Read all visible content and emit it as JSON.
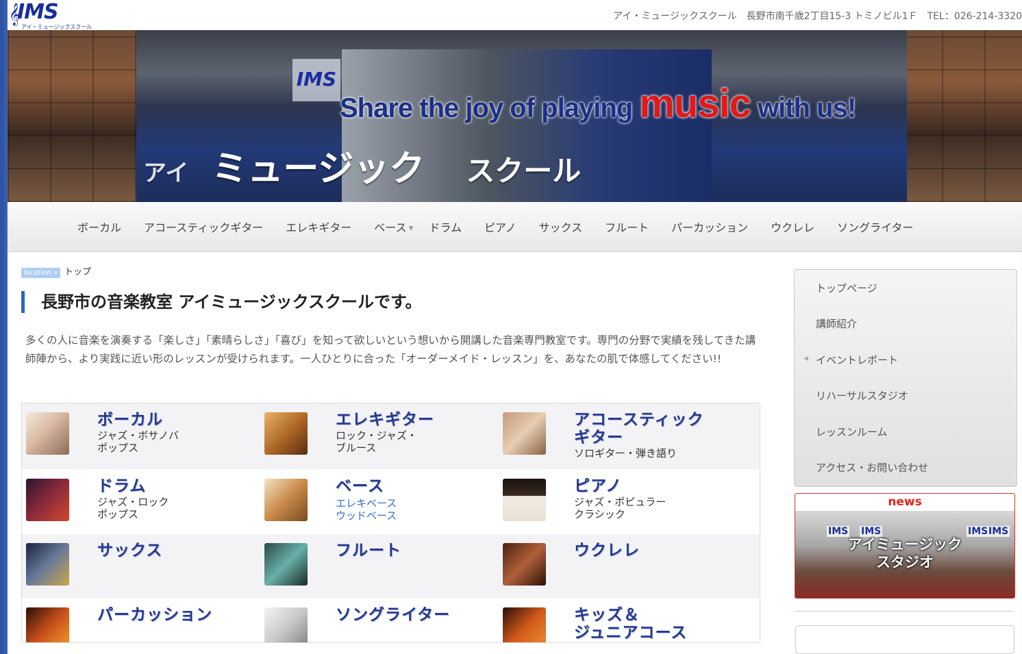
{
  "header": {
    "logo_text": "IMS",
    "logo_sub": "アイ・ミュージックスクール",
    "address": "アイ・ミュージックスクール　長野市南千歳2丁目15-3 トミノビル1Ｆ　TEL：026-214-3320"
  },
  "banner": {
    "slogan_pre": "Share the joy of playing ",
    "slogan_music": "music",
    "slogan_post": " with us!",
    "jp_a": "アイ",
    "jp_main": "ミュージック",
    "jp_school": "スクール",
    "logo": "IMS"
  },
  "nav": {
    "items": [
      "ボーカル",
      "アコースティックギター",
      "エレキギター",
      "ベース",
      "ドラム",
      "ピアノ",
      "サックス",
      "フルート",
      "パーカッション",
      "ウクレレ",
      "ソングライター"
    ]
  },
  "breadcrumb": {
    "tag": "location »",
    "current": "トップ"
  },
  "main": {
    "title": "長野市の音楽教室 アイミュージックスクールです。",
    "intro": "多くの人に音楽を演奏する「楽しさ」「素晴らしさ」「喜び」を知って欲しいという想いから開講した音楽専門教室です。専門の分野で実績を残してきた講師陣から、より実践に近い形のレッスンが受けられます。一人ひとりに合った「オーダーメイド・レッスン」を、あなたの肌で体感してください!!"
  },
  "courses": [
    {
      "name": "ボーカル",
      "name2": "",
      "sub1": "ジャズ・ボサノバ",
      "sub2": "ポップス",
      "sub_color": "dark"
    },
    {
      "name": "エレキギター",
      "name2": "",
      "sub1": "ロック・ジャズ・",
      "sub2": "ブルース",
      "sub_color": "dark"
    },
    {
      "name": "アコースティック",
      "name2": "ギター",
      "sub1": "ソロギター・弾き語り",
      "sub2": "",
      "sub_color": "dark"
    },
    {
      "name": "ドラム",
      "name2": "",
      "sub1": "ジャズ・ロック",
      "sub2": "ポップス",
      "sub_color": "dark"
    },
    {
      "name": "ベース",
      "name2": "",
      "sub1": "エレキベース",
      "sub2": "ウッドベース",
      "sub_color": "blue"
    },
    {
      "name": "ピアノ",
      "name2": "",
      "sub1": "ジャズ・ポピュラー",
      "sub2": "クラシック",
      "sub_color": "dark"
    },
    {
      "name": "サックス",
      "name2": "",
      "sub1": "",
      "sub2": "",
      "sub_color": "dark"
    },
    {
      "name": "フルート",
      "name2": "",
      "sub1": "",
      "sub2": "",
      "sub_color": "dark"
    },
    {
      "name": "ウクレレ",
      "name2": "",
      "sub1": "",
      "sub2": "",
      "sub_color": "dark"
    },
    {
      "name": "パーカッション",
      "name2": "",
      "sub1": "",
      "sub2": "",
      "sub_color": "dark"
    },
    {
      "name": "ソングライター",
      "name2": "",
      "sub1": "",
      "sub2": "",
      "sub_color": "dark"
    },
    {
      "name": "キッズ＆",
      "name2": "ジュニアコース",
      "sub1": "",
      "sub2": "",
      "sub_color": "dark"
    }
  ],
  "sidebar": {
    "items": [
      "トップページ",
      "講師紹介",
      "イベントレポート",
      "リハーサルスタジオ",
      "レッスンルーム",
      "アクセス・お問い合わせ"
    ]
  },
  "news": {
    "head": "news",
    "line1": "アイミュージック",
    "line2": "スタジオ",
    "ims": "IMS"
  },
  "colors": {
    "accent": "#2866c8",
    "course_title": "#23388f",
    "news_red": "#e0261e"
  }
}
